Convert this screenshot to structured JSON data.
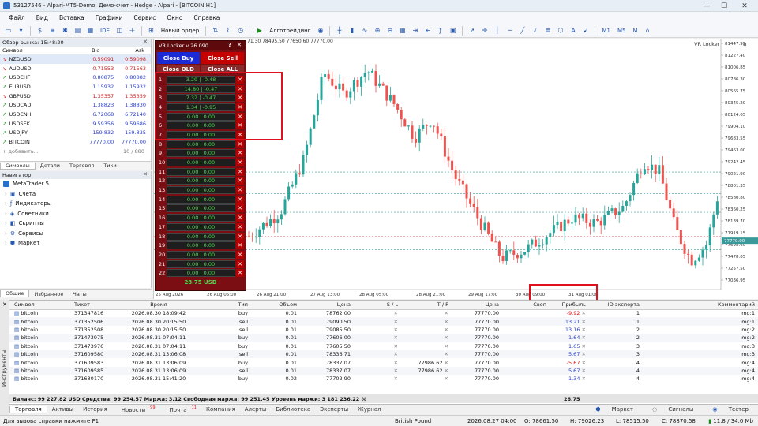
{
  "window": {
    "title": "53127546 - Alpari-MT5-Demo: Демо-счет - Hedge - Alpari - [BITCOIN,H1]"
  },
  "menu": [
    "Файл",
    "Вид",
    "Вставка",
    "Графики",
    "Сервис",
    "Окно",
    "Справка"
  ],
  "toolbar": {
    "ide": "IDE",
    "new_order": "Новый ордер",
    "algo": "Алготрейдинг",
    "timeframes": [
      "M1",
      "M5",
      "M"
    ]
  },
  "market_watch": {
    "title": "Обзор рынка: 15:48:20",
    "cols": [
      "Символ",
      "Bid",
      "Ask"
    ],
    "rows": [
      {
        "sym": "NZDUSD",
        "bid": "0.59091",
        "ask": "0.59098",
        "dir": "down"
      },
      {
        "sym": "AUDUSD",
        "bid": "0.71553",
        "ask": "0.71563",
        "dir": "down"
      },
      {
        "sym": "USDCHF",
        "bid": "0.80875",
        "ask": "0.80882",
        "dir": "up"
      },
      {
        "sym": "EURUSD",
        "bid": "1.15932",
        "ask": "1.15932",
        "dir": "up"
      },
      {
        "sym": "GBPUSD",
        "bid": "1.35357",
        "ask": "1.35359",
        "dir": "down"
      },
      {
        "sym": "USDCAD",
        "bid": "1.38823",
        "ask": "1.38830",
        "dir": "up"
      },
      {
        "sym": "USDCNH",
        "bid": "6.72068",
        "ask": "6.72140",
        "dir": "up"
      },
      {
        "sym": "USDSEK",
        "bid": "9.59356",
        "ask": "9.59686",
        "dir": "up"
      },
      {
        "sym": "USDJPY",
        "bid": "159.832",
        "ask": "159.835",
        "dir": "up"
      },
      {
        "sym": "BITCOIN",
        "bid": "77770.00",
        "ask": "77770.00",
        "dir": "up"
      }
    ],
    "add": "+ добавить...",
    "count": "10 / 880",
    "tabs": [
      "Символы",
      "Детали",
      "Торговля",
      "Тики"
    ]
  },
  "navigator": {
    "title": "Навигатор",
    "root": "MetaTrader 5",
    "items": [
      "Счета",
      "Индикаторы",
      "Советники",
      "Скрипты",
      "Сервисы",
      "Маркет"
    ],
    "tabs": [
      "Общие",
      "Избранное",
      "Чаты"
    ]
  },
  "chart": {
    "ohlc_text": "71.30 78495.50 77650.60 77770.00",
    "indicator_label": "VR Locker",
    "current_price": "77770.00",
    "y_ticks": [
      "81447.95",
      "81227.40",
      "81006.85",
      "80786.30",
      "80565.75",
      "80345.20",
      "80124.65",
      "79904.10",
      "79683.55",
      "79463.00",
      "79242.45",
      "79021.90",
      "78801.35",
      "78580.80",
      "78360.25",
      "78139.70",
      "77919.15",
      "77698.60",
      "77478.05",
      "77257.50",
      "77036.95"
    ],
    "x_ticks": [
      "25 Aug 2026",
      "26 Aug 05:00",
      "26 Aug 21:00",
      "27 Aug 13:00",
      "28 Aug 05:00",
      "28 Aug 21:00",
      "29 Aug 17:00",
      "30 Aug 09:00",
      "31 Aug 01:00"
    ],
    "bg": "#ffffff",
    "bull": "#26a69a",
    "bear": "#ef5350"
  },
  "vr_panel": {
    "title": "VR Locker v 26.090",
    "help": "?",
    "close": "✕",
    "close_buy": "Close Buy",
    "close_sell": "Close Sell",
    "close_old": "Close OLD",
    "close_all": "Close ALL",
    "rows": [
      "3.29 | -0.48",
      "14.80 | -0.47",
      "7.32 | -0.47",
      "1.34 | -0.95",
      "0.00 | 0.00",
      "0.00 | 0.00",
      "0.00 | 0.00",
      "0.00 | 0.00",
      "0.00 | 0.00",
      "0.00 | 0.00",
      "0.00 | 0.00",
      "0.00 | 0.00",
      "0.00 | 0.00",
      "0.00 | 0.00",
      "0.00 | 0.00",
      "0.00 | 0.00",
      "0.00 | 0.00",
      "0.00 | 0.00",
      "0.00 | 0.00",
      "0.00 | 0.00",
      "0.00 | 0.00",
      "0.00 | 0.00"
    ],
    "row_close": "✕",
    "total": "28.75 USD"
  },
  "trades": {
    "cols": [
      "Символ",
      "Тикет",
      "Время",
      "Тип",
      "Объем",
      "Цена",
      "S / L",
      "T / P",
      "Цена",
      "Своп",
      "Прибыль",
      "ID эксперта",
      "Комментарий"
    ],
    "rows": [
      {
        "sym": "bitcoin",
        "ticket": "371347816",
        "time": "2026.08.30 18:09:42",
        "type": "buy",
        "vol": "0.01",
        "price": "78762.00",
        "sl": "",
        "tp": "",
        "cur": "77770.00",
        "swap": "",
        "profit": "-9.92",
        "neg": true,
        "id": "1",
        "comment": "mg:1"
      },
      {
        "sym": "bitcoin",
        "ticket": "371352506",
        "time": "2026.08.30 20:15:50",
        "type": "sell",
        "vol": "0.01",
        "price": "79090.50",
        "sl": "",
        "tp": "",
        "cur": "77770.00",
        "swap": "",
        "profit": "13.21",
        "neg": false,
        "id": "1",
        "comment": "mg:1"
      },
      {
        "sym": "bitcoin",
        "ticket": "371352508",
        "time": "2026.08.30 20:15:50",
        "type": "sell",
        "vol": "0.01",
        "price": "79085.50",
        "sl": "",
        "tp": "",
        "cur": "77770.00",
        "swap": "",
        "profit": "13.16",
        "neg": false,
        "id": "2",
        "comment": "mg:2"
      },
      {
        "sym": "bitcoin",
        "ticket": "371473975",
        "time": "2026.08.31 07:04:11",
        "type": "buy",
        "vol": "0.01",
        "price": "77606.00",
        "sl": "",
        "tp": "",
        "cur": "77770.00",
        "swap": "",
        "profit": "1.64",
        "neg": false,
        "id": "2",
        "comment": "mg:2"
      },
      {
        "sym": "bitcoin",
        "ticket": "371473976",
        "time": "2026.08.31 07:04:11",
        "type": "buy",
        "vol": "0.01",
        "price": "77605.50",
        "sl": "",
        "tp": "",
        "cur": "77770.00",
        "swap": "",
        "profit": "1.65",
        "neg": false,
        "id": "3",
        "comment": "mg:3"
      },
      {
        "sym": "bitcoin",
        "ticket": "371609580",
        "time": "2026.08.31 13:06:08",
        "type": "sell",
        "vol": "0.01",
        "price": "78336.71",
        "sl": "",
        "tp": "",
        "cur": "77770.00",
        "swap": "",
        "profit": "5.67",
        "neg": false,
        "id": "3",
        "comment": "mg:3"
      },
      {
        "sym": "bitcoin",
        "ticket": "371609583",
        "time": "2026.08.31 13:06:09",
        "type": "buy",
        "vol": "0.01",
        "price": "78337.07",
        "sl": "",
        "tp": "77986.62",
        "cur": "77770.00",
        "swap": "",
        "profit": "-5.67",
        "neg": true,
        "id": "4",
        "comment": "mg:4"
      },
      {
        "sym": "bitcoin",
        "ticket": "371609585",
        "time": "2026.08.31 13:06:09",
        "type": "sell",
        "vol": "0.01",
        "price": "78337.07",
        "sl": "",
        "tp": "77986.62",
        "cur": "77770.00",
        "swap": "",
        "profit": "5.67",
        "neg": false,
        "id": "4",
        "comment": "mg:4"
      },
      {
        "sym": "bitcoin",
        "ticket": "371680170",
        "time": "2026.08.31 15:41:20",
        "type": "buy",
        "vol": "0.02",
        "price": "77702.90",
        "sl": "",
        "tp": "",
        "cur": "77770.00",
        "swap": "",
        "profit": "1.34",
        "neg": false,
        "id": "4",
        "comment": "mg:4"
      }
    ],
    "balance_line": "Баланс: 99 227.82 USD  Средства: 99 254.57  Маржа: 3.12  Свободная маржа: 99 251.45  Уровень маржи: 3 181 236.22 %",
    "total_profit": "26.75"
  },
  "toolbox": {
    "side_label": "Инструменты",
    "tabs": [
      "Торговля",
      "Активы",
      "История",
      "Новости",
      "Почта",
      "Компания",
      "Алерты",
      "Библиотека",
      "Эксперты",
      "Журнал"
    ],
    "news_badge": "99",
    "mail_badge": "11",
    "right": [
      "Маркет",
      "Сигналы",
      "Тестер"
    ]
  },
  "status": {
    "help": "Для вызова справки нажмите F1",
    "profile": "British Pound",
    "dt": "2026.08.27 04:00",
    "o": "O: 78661.50",
    "h": "H: 79026.23",
    "l": "L: 78515.50",
    "c": "C: 78870.58",
    "net": "11.8 / 34.0 Mb"
  }
}
